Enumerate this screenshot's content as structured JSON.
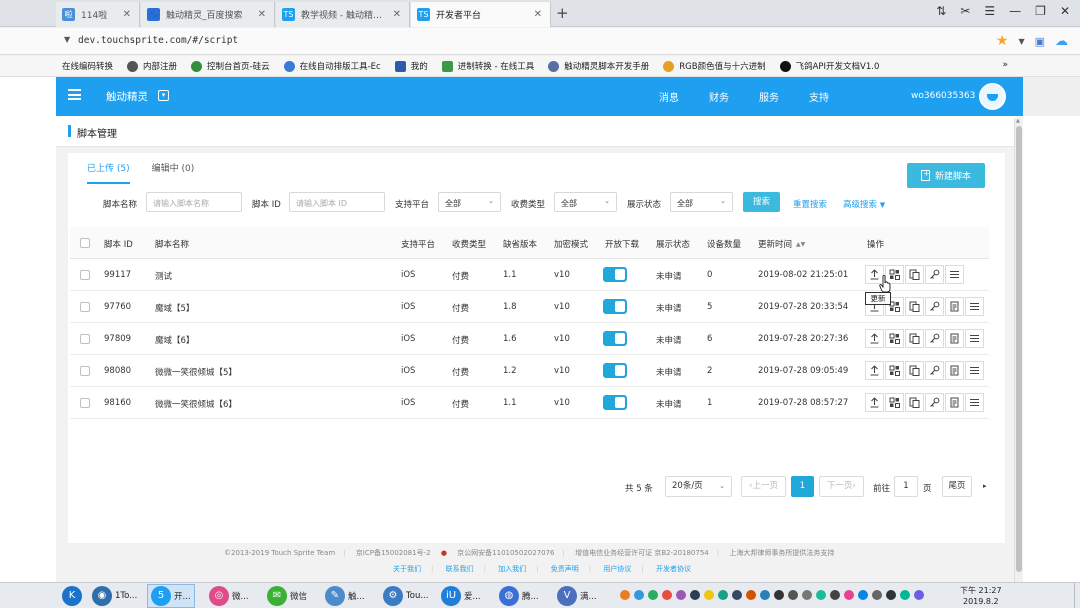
{
  "browser": {
    "tabs": [
      {
        "label": "114啦",
        "icon_text": "啦",
        "color": "#4a90d9"
      },
      {
        "label": "触动精灵_百度搜索",
        "icon_text": "🐾",
        "color": "#2a6fd6"
      },
      {
        "label": "教学视频 - 触动精灵官",
        "icon_text": "TS",
        "color": "#1e9ff0"
      },
      {
        "label": "开发者平台",
        "icon_text": "TS",
        "color": "#1e9ff0"
      }
    ],
    "new_tab": "+",
    "url": "dev.touchsprite.com/#/script",
    "bookmarks": [
      "在线编码转换",
      "内部注册",
      "控制台首页-硅云",
      "在线自动排版工具-Ec",
      "我的",
      "进制转换 - 在线工具",
      "触动精灵脚本开发手册",
      "RGB颜色值与十六进制",
      "飞鸽API开发文档V1.0"
    ],
    "bookmarks_more": "»"
  },
  "header": {
    "brand": "触动精灵",
    "nav": [
      "消息",
      "财务",
      "服务",
      "支持"
    ],
    "username": "wo366035363",
    "accent": "#1e9ff0"
  },
  "page": {
    "title": "脚本管理",
    "tabs": [
      "已上传 (5)",
      "编辑中 (0)"
    ],
    "new_button": "新建脚本",
    "filters": {
      "name_label": "脚本名称",
      "name_placeholder": "请输入脚本名称",
      "id_label": "脚本 ID",
      "id_placeholder": "请输入脚本 ID",
      "platform_label": "支持平台",
      "platform_value": "全部",
      "charge_label": "收费类型",
      "charge_value": "全部",
      "status_label": "展示状态",
      "status_value": "全部",
      "search": "搜索",
      "reset": "重置搜索",
      "advanced": "高级搜索"
    },
    "columns": [
      "脚本 ID",
      "脚本名称",
      "支持平台",
      "收费类型",
      "缺省版本",
      "加密模式",
      "开放下载",
      "展示状态",
      "设备数量",
      "更新时间",
      "操作"
    ],
    "rows": [
      {
        "id": "99117",
        "name": "测试",
        "platform": "iOS",
        "charge": "付费",
        "version": "1.1",
        "enc": "v10",
        "status": "未申请",
        "devices": "0",
        "updated": "2019-08-02 21:25:01"
      },
      {
        "id": "97760",
        "name": "魔域【5】",
        "platform": "iOS",
        "charge": "付费",
        "version": "1.8",
        "enc": "v10",
        "status": "未申请",
        "devices": "5",
        "updated": "2019-07-28 20:33:54"
      },
      {
        "id": "97809",
        "name": "魔域【6】",
        "platform": "iOS",
        "charge": "付费",
        "version": "1.6",
        "enc": "v10",
        "status": "未申请",
        "devices": "6",
        "updated": "2019-07-28 20:27:36"
      },
      {
        "id": "98080",
        "name": "微微一笑很倾城【5】",
        "platform": "iOS",
        "charge": "付费",
        "version": "1.2",
        "enc": "v10",
        "status": "未申请",
        "devices": "2",
        "updated": "2019-07-28 09:05:49"
      },
      {
        "id": "98160",
        "name": "微微一笑很倾城【6】",
        "platform": "iOS",
        "charge": "付费",
        "version": "1.1",
        "enc": "v10",
        "status": "未申请",
        "devices": "1",
        "updated": "2019-07-28 08:57:27"
      }
    ],
    "tooltip": "更新",
    "pager": {
      "total": "共 5 条",
      "per_page": "20条/页",
      "prev": "‹上一页",
      "current": "1",
      "next": "下一页›",
      "goto": "前往",
      "goto_value": "1",
      "page_unit": "页",
      "last": "尾页"
    },
    "footer": {
      "line1": [
        "©2013-2019 Touch Sprite Team",
        "京ICP备15002081号-2",
        "京公网安备11010502027076",
        "增值电信业务经营许可证 京B2-20180754",
        "上海大邦律师事务所提供法务支持"
      ],
      "line2": [
        "关于我们",
        "联系我们",
        "加入我们",
        "免责声明",
        "用户协议",
        "开发者协议"
      ]
    }
  },
  "taskbar": {
    "items": [
      {
        "label": "",
        "icon": "K",
        "color": "#1a73c8"
      },
      {
        "label": "1To...",
        "icon": "◉",
        "color": "#2f6ea8"
      },
      {
        "label": "开...",
        "icon": "5",
        "color": "#1e9ff0",
        "active": true
      },
      {
        "label": "微...",
        "icon": "◎",
        "color": "#e04b8a"
      },
      {
        "label": "微信",
        "icon": "✉",
        "color": "#3cb034"
      },
      {
        "label": "触...",
        "icon": "✎",
        "color": "#4c8bc9"
      },
      {
        "label": "Tou...",
        "icon": "⚙",
        "color": "#3a7cc4"
      },
      {
        "label": "爱...",
        "icon": "iU",
        "color": "#1f7fd8"
      },
      {
        "label": "腾...",
        "icon": "◍",
        "color": "#3a6fd8"
      },
      {
        "label": "满...",
        "icon": "V",
        "color": "#4d6fbf"
      }
    ],
    "time": "下午 21:27",
    "date": "2019.8.2"
  }
}
